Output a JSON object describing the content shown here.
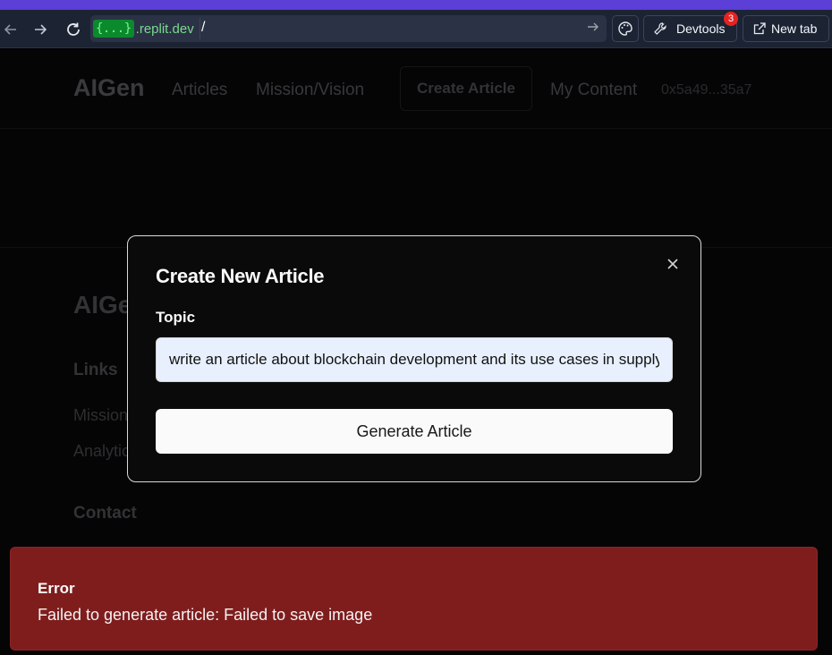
{
  "browser": {
    "url_chip": "{...}",
    "url_domain": ".replit.dev",
    "url_path": "/",
    "devtools_label": "Devtools",
    "devtools_badge": "3",
    "new_tab_label": "New tab",
    "accent_color": "#5b3fd6"
  },
  "site": {
    "logo": "AIGen",
    "nav": [
      "Articles",
      "Mission/Vision",
      "Create Article",
      "My Content"
    ],
    "wallet": "0x5a49...35a7",
    "footer": {
      "logo": "AIGen",
      "links_heading": "Links",
      "links": [
        "Mission/Vision",
        "Analytics"
      ],
      "contact_heading": "Contact"
    }
  },
  "modal": {
    "title": "Create New Article",
    "topic_label": "Topic",
    "topic_value": "write an article about blockchain development and its use cases in supply chain management",
    "generate_label": "Generate Article"
  },
  "toast": {
    "title": "Error",
    "description": "Failed to generate article: Failed to save image",
    "color": "#7f1d1d"
  }
}
